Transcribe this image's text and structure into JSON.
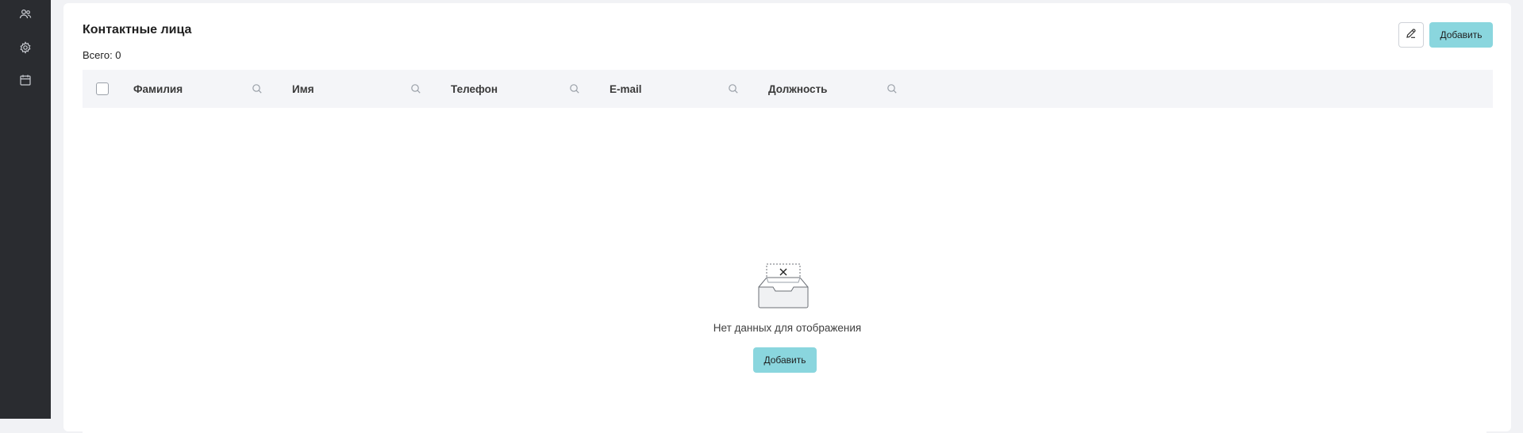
{
  "sidebar": {
    "items": [
      {
        "icon": "users-icon"
      },
      {
        "icon": "gear-icon"
      },
      {
        "icon": "calendar-icon"
      }
    ]
  },
  "header": {
    "title": "Контактные лица",
    "total": "Всего: 0",
    "edit_icon": "pencil-icon",
    "add_label": "Добавить"
  },
  "table": {
    "columns": [
      {
        "label": "Фамилия"
      },
      {
        "label": "Имя"
      },
      {
        "label": "Телефон"
      },
      {
        "label": "E-mail"
      },
      {
        "label": "Должность"
      }
    ]
  },
  "empty": {
    "icon": "empty-inbox-icon",
    "message": "Нет данных для отображения",
    "add_label": "Добавить"
  },
  "colors": {
    "sidebar_bg": "#2a2c30",
    "accent": "#8ad6de",
    "page_bg": "#f1f2f5",
    "table_head_bg": "#f4f5f8"
  }
}
